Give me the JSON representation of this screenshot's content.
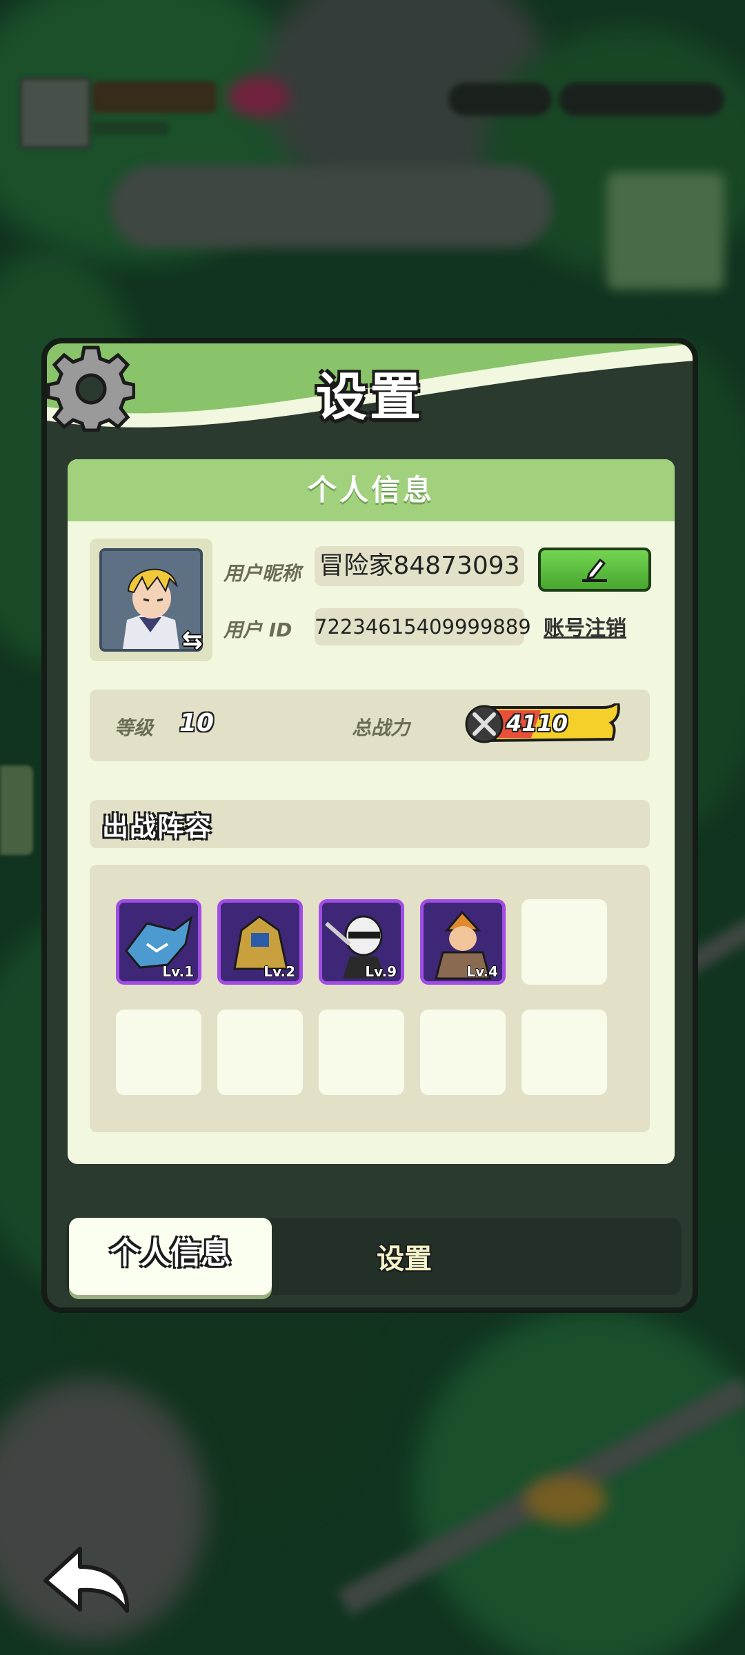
{
  "panel": {
    "title": "设置"
  },
  "profile": {
    "section_header": "个人信息",
    "nickname_label": "用户昵称",
    "nickname_value": "冒险家84873093",
    "id_label": "用户 ID",
    "id_value": "72234615409999889",
    "logout_label": "账号注销",
    "edit_icon": "pencil-edit-icon",
    "swap_icon": "swap-arrows-icon"
  },
  "stats": {
    "level_label": "等级",
    "level_value": "10",
    "power_label": "总战力",
    "power_value": "4110",
    "power_icon": "crossed-swords-icon"
  },
  "lineup": {
    "title": "出战阵容",
    "heroes": [
      {
        "lv": "Lv.1",
        "color": "#3b6fa8"
      },
      {
        "lv": "Lv.2",
        "color": "#c59a3a"
      },
      {
        "lv": "Lv.9",
        "color": "#ececec"
      },
      {
        "lv": "Lv.4",
        "color": "#d98a38"
      }
    ]
  },
  "tabs": {
    "active": "个人信息",
    "inactive": "设置"
  },
  "colors": {
    "header_green": "#89c46a",
    "card_bg": "#f2f8df",
    "hero_frame": "#a24ce6",
    "edit_button": "#5bbd3c"
  }
}
